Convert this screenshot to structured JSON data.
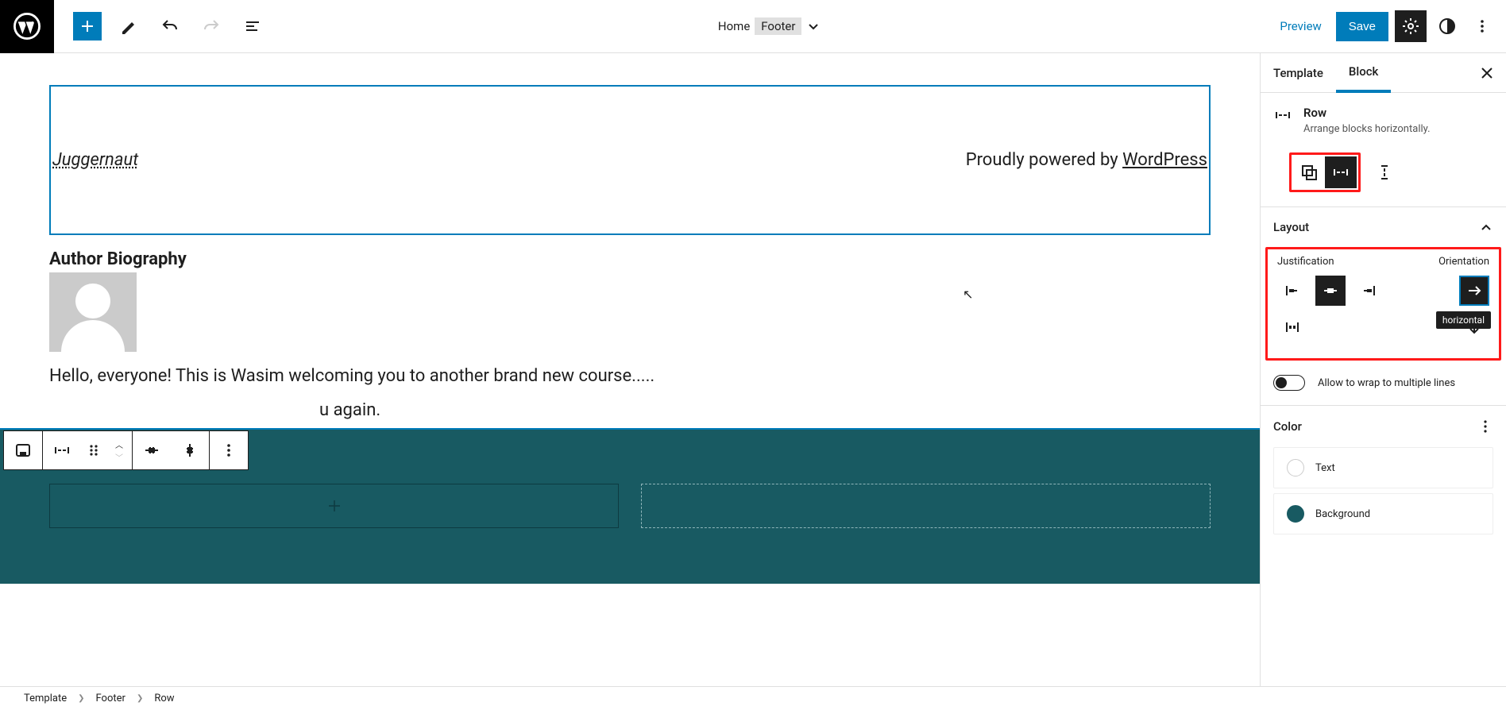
{
  "topbar": {
    "home": "Home",
    "footer_badge": "Footer",
    "preview": "Preview",
    "save": "Save"
  },
  "canvas": {
    "site_title": "Juggernaut",
    "powered_prefix": "Proudly powered by ",
    "powered_link": "WordPress",
    "author_bio_heading": "Author Biography",
    "bio_text": "Hello, everyone! This is Wasim welcoming you to another brand new course.....",
    "hello_again_suffix": "u again."
  },
  "breadcrumb": {
    "a": "Template",
    "b": "Footer",
    "c": "Row"
  },
  "sidebar": {
    "tabs": {
      "template": "Template",
      "block": "Block"
    },
    "block": {
      "title": "Row",
      "desc": "Arrange blocks horizontally."
    },
    "layout": {
      "heading": "Layout",
      "justification": "Justification",
      "orientation": "Orientation",
      "tooltip": "horizontal"
    },
    "wrap_label": "Allow to wrap to multiple lines",
    "color": {
      "heading": "Color",
      "text": "Text",
      "background": "Background"
    }
  }
}
